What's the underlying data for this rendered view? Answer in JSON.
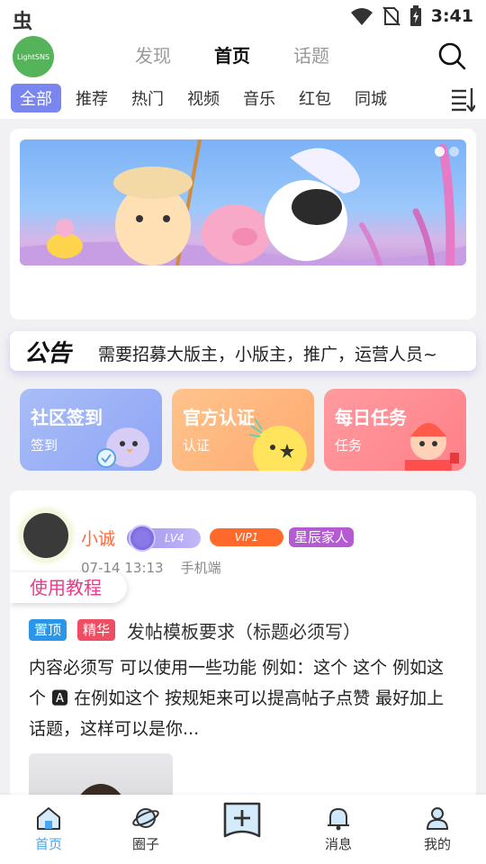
{
  "status": {
    "time": "3:41",
    "app_glyph": "虫"
  },
  "header": {
    "logo_text": "LightSNS",
    "tabs": [
      {
        "label": "发现"
      },
      {
        "label": "首页"
      },
      {
        "label": "话题"
      }
    ],
    "active_tab": "首页"
  },
  "categories": {
    "items": [
      "全部",
      "推荐",
      "热门",
      "视频",
      "音乐",
      "红包",
      "同城"
    ],
    "active": "全部"
  },
  "notice": {
    "title": "公告",
    "text": "需要招募大版主，小版主，推广，运营人员~"
  },
  "quick": [
    {
      "title": "社区签到",
      "subtitle": "签到"
    },
    {
      "title": "官方认证",
      "subtitle": "认证"
    },
    {
      "title": "每日任务",
      "subtitle": "任务"
    }
  ],
  "post": {
    "user": "小诚",
    "level": "LV4",
    "vip": "VIP1",
    "badge": "星辰家人",
    "date": "07-14 13:13",
    "client": "手机端",
    "tutorial": "使用教程",
    "tag_top": "置顶",
    "tag_essence": "精华",
    "title": "发帖模板要求（标题必须写）",
    "body": "内容必须写 可以使用一些功能 例如：这个 这个 例如这个 🅰 在例如这个 按规矩来可以提高帖子点赞 最好加上话题，这样可以是你..."
  },
  "bottom_nav": [
    {
      "label": "首页"
    },
    {
      "label": "圈子"
    },
    {
      "label": "消息"
    },
    {
      "label": "我的"
    }
  ],
  "colors": {
    "accent": "#7a86f0",
    "nav_active": "#4aa6f0",
    "username": "#ff6a39"
  }
}
